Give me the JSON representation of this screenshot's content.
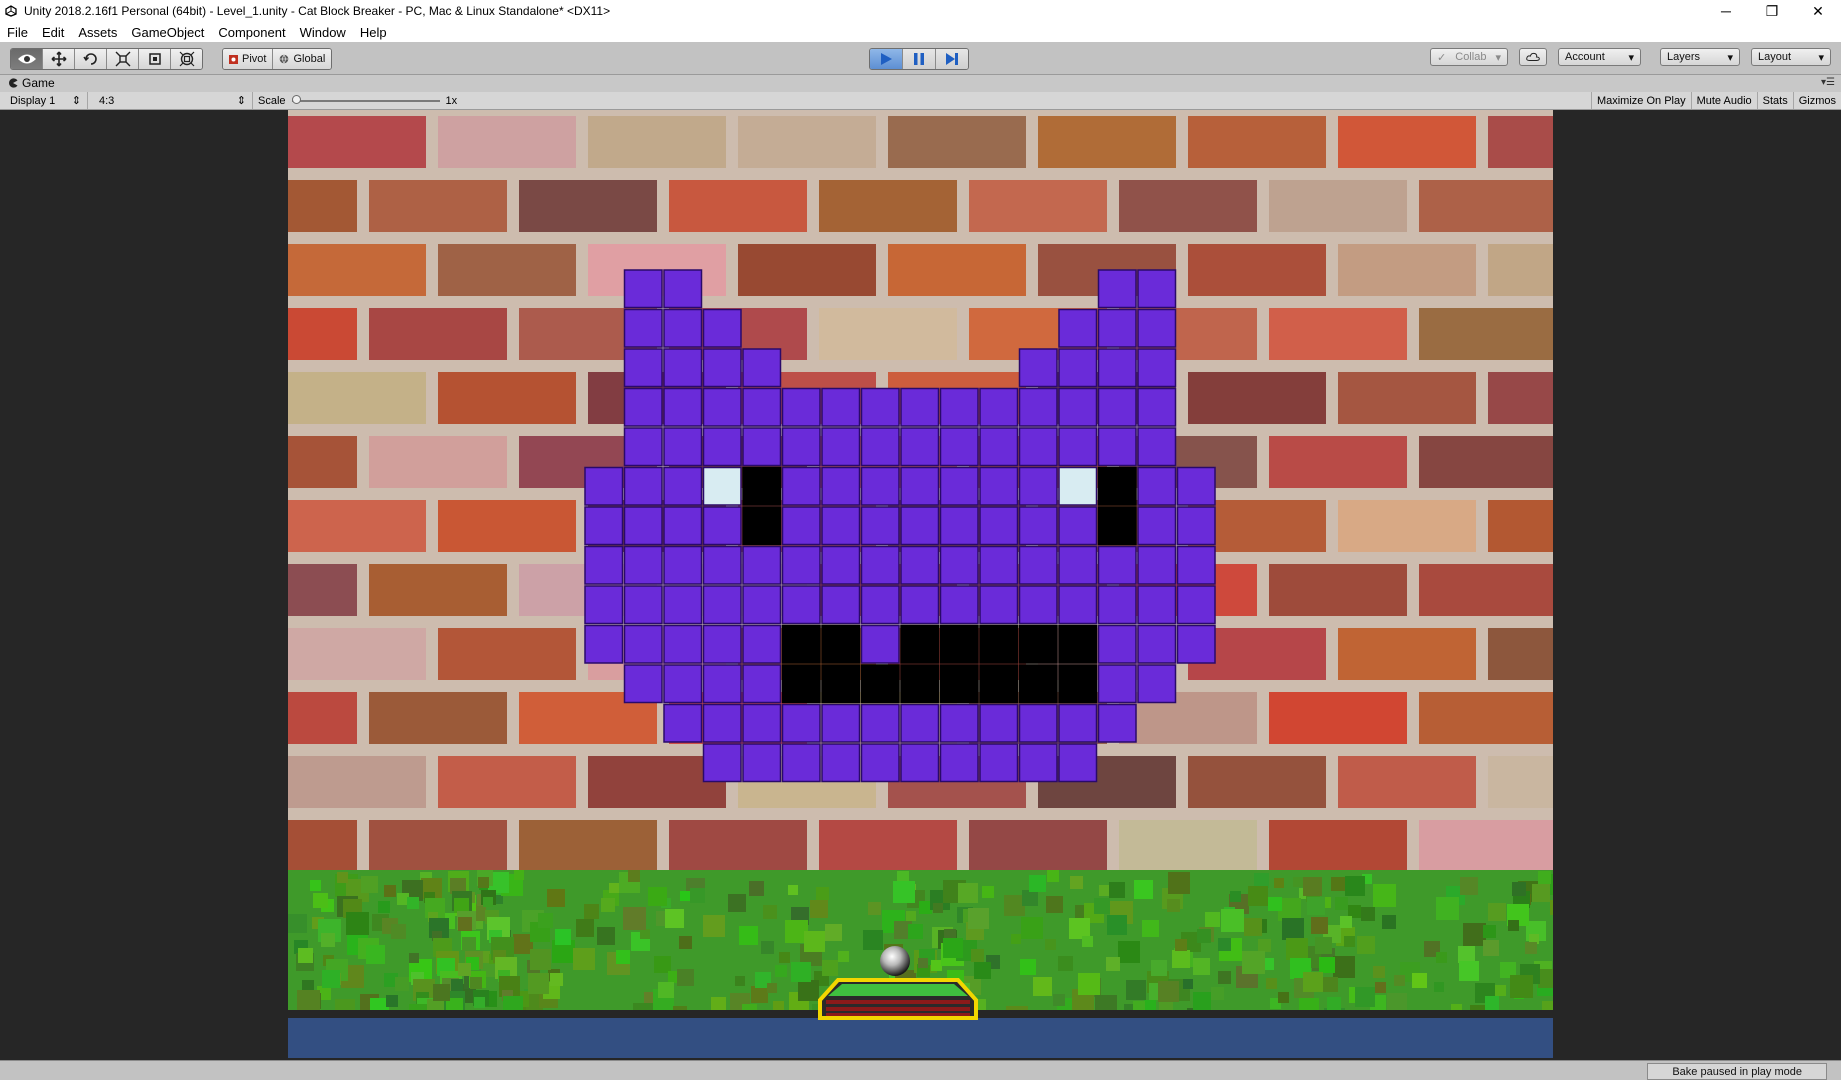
{
  "window": {
    "title": "Unity 2018.2.16f1 Personal (64bit) - Level_1.unity - Cat Block Breaker - PC, Mac & Linux Standalone* <DX11>",
    "minimize": "─",
    "restore": "❐",
    "close": "✕"
  },
  "menu": [
    "File",
    "Edit",
    "Assets",
    "GameObject",
    "Component",
    "Window",
    "Help"
  ],
  "toolbar": {
    "tools": [
      {
        "name": "hand-tool",
        "icon": "eye-icon"
      },
      {
        "name": "move-tool",
        "icon": "move-icon"
      },
      {
        "name": "rotate-tool",
        "icon": "rotate-icon"
      },
      {
        "name": "scale-tool",
        "icon": "scale-icon"
      },
      {
        "name": "rect-tool",
        "icon": "rect-icon"
      },
      {
        "name": "transform-tool",
        "icon": "transform-icon"
      }
    ],
    "pivot_label": "Pivot",
    "global_label": "Global",
    "play_state": {
      "playing": true,
      "paused": false
    },
    "collab_label": "Collab",
    "account_label": "Account",
    "layers_label": "Layers",
    "layout_label": "Layout"
  },
  "game_panel": {
    "tab_label": "Game",
    "display": "Display 1",
    "aspect": "4:3",
    "scale_label": "Scale",
    "scale_value": "1x",
    "scale_level": 0,
    "buttons": [
      "Maximize On Play",
      "Mute Audio",
      "Stats",
      "Gizmos"
    ]
  },
  "scene": {
    "brick_color": "#6a2bd9",
    "brick_border": "#2a0a6a",
    "eye_color": "#d8ecf2",
    "paddle_colors": {
      "outline": "#f2d600",
      "top": "#3fbf3f",
      "stripes": "#8b1a1a"
    },
    "wall_color": "#a8644e",
    "grass_color": "#3f9a2a",
    "floor_color": "#334f82"
  },
  "status": {
    "text": "Bake paused in play mode"
  }
}
